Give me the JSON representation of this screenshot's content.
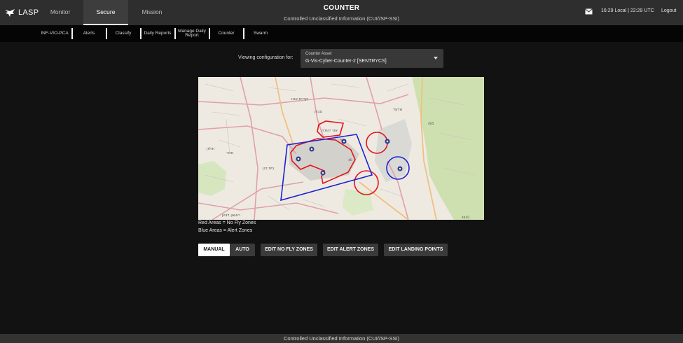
{
  "app": {
    "name": "LASP"
  },
  "nav": {
    "tabs": [
      {
        "label": "Monitor"
      },
      {
        "label": "Secure"
      },
      {
        "label": "Mission"
      }
    ]
  },
  "header": {
    "title": "COUNTER",
    "classification": "Controlled Unclassified Information (CUI//SP-SSI)"
  },
  "clock": {
    "text": "16:29 Local | 22:29 UTC",
    "logout": "Logout"
  },
  "subnav": {
    "items": [
      {
        "label": "INF-VIO-PCA"
      },
      {
        "label": "Alerts"
      },
      {
        "label": "Classify"
      },
      {
        "label": "Daily Reports"
      },
      {
        "label": "Manage Daily Report"
      },
      {
        "label": "Counter"
      },
      {
        "label": "Swarm"
      }
    ]
  },
  "config": {
    "label": "Viewing configuration for:",
    "field_label": "Counter Asset",
    "value": "G-Vis-Cyber-Counter-2 [SENTRYCS]"
  },
  "map": {
    "labels": [
      {
        "text": "קריית אונו"
      },
      {
        "text": "סביון"
      },
      {
        "text": "אור יהודה"
      },
      {
        "text": "יהוד"
      },
      {
        "text": "חולון"
      },
      {
        "text": "אזור"
      },
      {
        "text": "בית דגן"
      },
      {
        "text": "ראשון לציון"
      },
      {
        "text": "אלעד"
      },
      {
        "text": "465"
      },
      {
        "text": "40"
      },
      {
        "text": "4402"
      }
    ]
  },
  "legend": {
    "red": "Red Areas = No Fly Zones",
    "blue": "Blue Areas = Alert Zones"
  },
  "buttons": {
    "manual": "MANUAL",
    "auto": "AUTO",
    "edit_nfz": "EDIT NO FLY ZONES",
    "edit_alert": "EDIT ALERT ZONES",
    "edit_landing": "EDIT LANDING POINTS"
  },
  "colors": {
    "no_fly": "#e3141c",
    "alert": "#1a22d6",
    "marker": "#2d3a8c",
    "accent": "#ffffff"
  },
  "icons": {
    "logo": "eagle-icon",
    "mail": "envelope-icon",
    "caret": "chevron-down-icon",
    "marker": "drone-marker-icon"
  },
  "footer": {
    "classification": "Controlled Unclassified Information (CUI//SP-SSI)"
  }
}
